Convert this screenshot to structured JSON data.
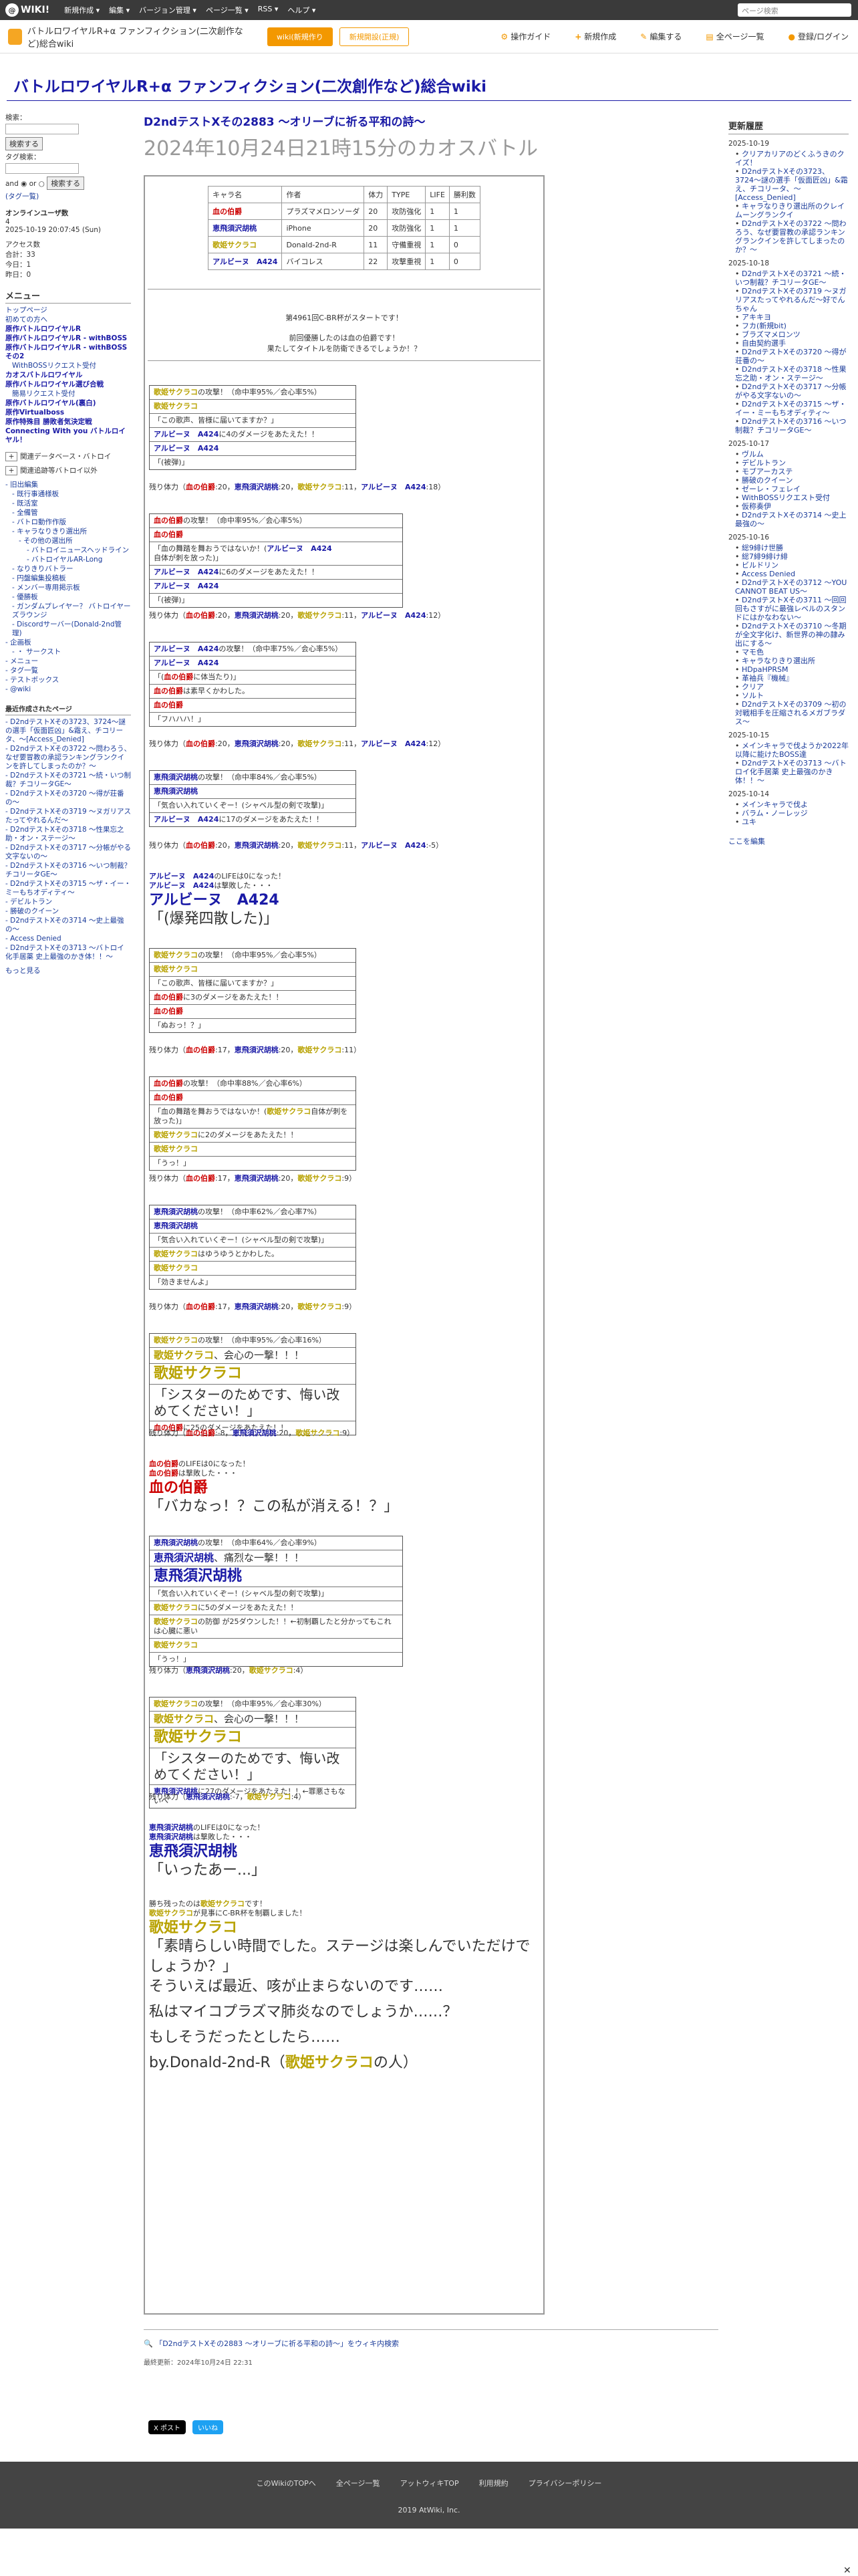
{
  "topbar": {
    "logo": "WIKI!",
    "menu": [
      "新規作成 ▾",
      "編集 ▾",
      "バージョン管理 ▾",
      "ページ一覧 ▾",
      "RSS ▾",
      "ヘルプ ▾"
    ],
    "search_placeholder": "ページ検索"
  },
  "toolbar": {
    "site_name": "バトルロワイヤルR+α ファンフィクション(二次創作など)総合wiki",
    "btn_wiki": "wiki(新規作り",
    "btn_rent": "新規開設(正規)",
    "actions": [
      {
        "icon": "⚙",
        "label": "操作ガイド"
      },
      {
        "icon": "+",
        "label": "新規作成"
      },
      {
        "icon": "✎",
        "label": "編集する"
      },
      {
        "icon": "▤",
        "label": "全ページ一覧"
      },
      {
        "icon": "●",
        "label": "登録/ログイン"
      }
    ]
  },
  "wiki_title": "バトルロワイヤルR+α ファンフィクション(二次創作など)総合wiki",
  "left": {
    "search_label1": "検索：",
    "search_button": "検索する",
    "tag_label": "タグ検索：",
    "and_or": "and ◉ or ○",
    "search_button2": "検索する",
    "tag_link": "(タグ一覧)",
    "online_label": "オンラインユーザ数",
    "online_count": "4",
    "online_time": "2025-10-19 20:07:45 (Sun)",
    "counter": [
      "アクセス数",
      "合計：33",
      "今日：1",
      "昨日：0"
    ],
    "menu_title": "メニュー",
    "menu": [
      {
        "label": "トップページ",
        "level": 0,
        "bold": false
      },
      {
        "label": "初めての方へ",
        "level": 0,
        "bold": false
      },
      {
        "label": "原作バトルロワイヤルR",
        "level": 0,
        "bold": true
      },
      {
        "label": "原作バトルロワイヤルR - withBOSS",
        "level": 0,
        "bold": true
      },
      {
        "label": "原作バトルロワイヤルR - withBOSSその2",
        "level": 0,
        "bold": true
      },
      {
        "label": "WithBOSSリクエスト受付",
        "level": 1,
        "bold": false
      },
      {
        "label": "カオスバトルロワイヤル",
        "level": 0,
        "bold": true
      },
      {
        "label": "原作バトルロワイヤル選び合戦",
        "level": 0,
        "bold": true
      },
      {
        "label": "簡易リクエスト受付",
        "level": 1,
        "bold": false
      },
      {
        "label": "原作バトルロワイヤル(裏白)",
        "level": 0,
        "bold": true
      },
      {
        "label": "原作Virtualboss",
        "level": 0,
        "bold": true
      },
      {
        "label": "原作特殊目 勝敗者気決定戦",
        "level": 0,
        "bold": true
      },
      {
        "label": "Connecting With you バトルロイヤル！",
        "level": 0,
        "bold": true
      }
    ],
    "fold1": "関連データベース・バトロイ",
    "fold2": "関連追跡等バトロイ以外",
    "tree": [
      {
        "label": "旧出編集",
        "level": 0
      },
      {
        "label": "既行事通様板",
        "level": 1
      },
      {
        "label": "既活室",
        "level": 1
      },
      {
        "label": "全備管",
        "level": 1
      },
      {
        "label": "バトロ動作作版",
        "level": 1
      },
      {
        "label": "キャラなりきり選出所",
        "level": 1
      },
      {
        "label": "その他の選出所",
        "level": 2
      },
      {
        "label": "バトロイニュースヘッドライン",
        "level": 3
      },
      {
        "label": "バトロイヤルAR-Long",
        "level": 3
      },
      {
        "label": "なりきりバトラー",
        "level": 1
      },
      {
        "label": "円盤編集投稿板",
        "level": 1
      },
      {
        "label": "メンバー専用掲示板",
        "level": 1
      },
      {
        "label": "優勝板",
        "level": 1
      },
      {
        "label": "ガンダムプレイヤー？ バトロイヤーズラウンジ",
        "level": 1
      },
      {
        "label": "Discordサーバー(Donald-2nd管理)",
        "level": 1
      },
      {
        "label": "企画板",
        "level": 0
      },
      {
        "label": "・ サークスト",
        "level": 1
      },
      {
        "label": "メニュー",
        "level": 0
      },
      {
        "label": "タグ一覧",
        "level": 0
      },
      {
        "label": "テストボックス",
        "level": 0
      },
      {
        "label": "@wiki",
        "level": 0
      }
    ],
    "recent_title": "最近作成されたページ",
    "recent": [
      "D2ndテストXその3723、3724〜謎の選手「仮面匠凶」&霜え、チコリータ、〜[Access_Denied]",
      "D2ndテストXその3722 〜問わろう、なぜ要冒教の承認ランキングランクインを許してしまったのか？〜",
      "D2ndテストXその3721 〜続・いつ制裁？チコリータGE〜",
      "D2ndテストXその3720 〜得が荘番の〜",
      "D2ndテストXその3719 〜ヌガリアスたってやれるんだ〜",
      "D2ndテストXその3718 〜性果忘之助・オン・ステージ〜",
      "D2ndテストXその3717 〜分帳がやる文字ないの〜",
      "D2ndテストXその3716 〜いつ制裁？チコリータGE〜",
      "D2ndテストXその3715 〜ザ・イー・ミーもちオディティ〜",
      "デビルトラン",
      "勝破のクイーン",
      "D2ndテストXその3714 〜史上最強の〜",
      "Access Denied",
      "D2ndテストXその3713 〜バトロイ化手居薬 史上最強のかき体！！〜"
    ],
    "more": "もっと見る"
  },
  "right": {
    "title": "更新履歴",
    "groups": [
      {
        "date": "2025-10-19",
        "items": [
          "クリアカリアのどくふうきのクイズ！",
          "D2ndテストXその3723、3724〜謎の選手「仮面匠凶」&霜え、チコリータ、〜[Access_Denied]",
          "キャラなりきり選出所のクレイムーングランクイ",
          "D2ndテストXその3722 〜問わろう、なぜ要冒教の承認ランキングランクインを許してしまったのか？〜"
        ]
      },
      {
        "date": "2025-10-18",
        "items": [
          "D2ndテストXその3721 〜続・いつ制裁？チコリータGE〜",
          "D2ndテストXその3719 〜ヌガリアスたってやれるんだ〜好でんちゃん",
          "アキキヨ",
          "フカ(新規bit)",
          "ブラズマメロンツ",
          "自由契約選手",
          "D2ndテストXその3720 〜得が荘番の〜",
          "D2ndテストXその3718 〜性果忘之助・オン・ステージ〜",
          "D2ndテストXその3717 〜分帳がやる文字ないの〜",
          "D2ndテストXその3715 〜ザ・イー・ミーもちオディティ〜",
          "D2ndテストXその3716 〜いつ制裁？チコリータGE〜"
        ]
      },
      {
        "date": "2025-10-17",
        "items": [
          "ヴルム",
          "デビルトラン",
          "モブアーカステ",
          "勝破のクイーン",
          "ゼーレ・フェレイ",
          "WithBOSSリクエスト受付",
          "仮称奏伊",
          "D2ndテストXその3714 〜史上最強の〜"
        ]
      },
      {
        "date": "2025-10-16",
        "items": [
          "総9緋け世勝",
          "総7緋9緋け緋",
          "ビルドリン",
          "Access Denied",
          "D2ndテストXその3712 〜YOU CANNOT BEAT US〜",
          "D2ndテストXその3711 〜回回回もさすがに最強レベルのスタンドにはかなわない〜",
          "D2ndテストXその3710 〜冬期が全文字化け、新世界の神の隷み出にする〜",
          "マモ色",
          "キャラなりきり選出所",
          "HDpaHPRSM",
          "革袖兵『機械』",
          "クリア",
          "ソルト",
          "D2ndテストXその3709 〜初の対戦相手を圧縮されるメガブラダス〜"
        ]
      },
      {
        "date": "2025-10-15",
        "items": [
          "メインキャラで伐ようか2022年以降に能けたBOSS達",
          "D2ndテストXその3713 〜バトロイ化手居薬 史上最強のかき体！！〜"
        ]
      },
      {
        "date": "2025-10-14",
        "items": [
          "メインキャラで伐よ",
          "バラム・ノーレッジ",
          "ユキ"
        ]
      }
    ],
    "more": "ここを編集"
  },
  "page": {
    "h1": "D2ndテストXその2883 〜オリーブに祈る平和の詩〜",
    "h2": "2024年10月24日21時15分のカオスバトル",
    "status_table": {
      "headers": [
        "キャラ名",
        "作者",
        "体力",
        "TYPE",
        "LIFE",
        "勝利数"
      ],
      "rows": [
        [
          "血の伯爵",
          "プラズマメロンソーダ",
          "20",
          "攻防強化",
          "1",
          "1"
        ],
        [
          "恵飛須沢胡桃",
          "iPhone",
          "20",
          "攻防強化",
          "1",
          "1"
        ],
        [
          "歌姫サクラコ",
          "Donald-2nd-R",
          "11",
          "守備重視",
          "1",
          "0"
        ],
        [
          "アルビーヌ　A424",
          "バイコレス",
          "22",
          "攻撃重視",
          "1",
          "0"
        ]
      ]
    },
    "intro1": "第4961回C-BR杯がスタートです！",
    "intro2": "前回優勝したのは血の伯爵です！",
    "intro3": "果たしてタイトルを防衛できるでしょうか！？",
    "blocks": [
      {
        "rows": [
          "歌姫サクラコの攻撃！（命中率95%／会心率5%）",
          "歌姫サクラコ",
          "「この歌声、皆様に届いてますか？」",
          "アルビーヌ　A424に4のダメージをあたえた！！",
          "アルビーヌ　A424",
          "「(被弾)」"
        ],
        "life": "残り体力（血の伯爵:20，恵飛須沢胡桃:20，歌姫サクラコ:11，アルビーヌ　A424:18）"
      },
      {
        "rows": [
          "血の伯爵の攻撃！（命中率95%／会心率5%）",
          "血の伯爵",
          "「血の舞踏を舞おうではないか！(アルビーヌ　A424自体が刺を放った)」",
          "アルビーヌ　A424に6のダメージをあたえた！！",
          "アルビーヌ　A424",
          "「(被弾)」"
        ],
        "life": "残り体力（血の伯爵:20，恵飛須沢胡桃:20，歌姫サクラコ:11，アルビーヌ　A424:12）"
      },
      {
        "rows": [
          "アルビーヌ　A424の攻撃！（命中率75%／会心率5%）",
          "アルビーヌ　A424",
          "「(血の伯爵に体当たり)」",
          "血の伯爵は素早くかわした。",
          "血の伯爵",
          "「フハハハ！」"
        ],
        "life": "残り体力（血の伯爵:20，恵飛須沢胡桃:20，歌姫サクラコ:11，アルビーヌ　A424:12）"
      },
      {
        "rows": [
          "恵飛須沢胡桃の攻撃！（命中率84%／会心率5%）",
          "恵飛須沢胡桃",
          "「気合い入れていくぞー！(シャベル型の剣で攻撃)」",
          "アルビーヌ　A424に17のダメージをあたえた！！"
        ],
        "life": "残り体力（血の伯爵:20，恵飛須沢胡桃:20，歌姫サクラコ:11，アルビーヌ　A424:-5）"
      },
      {
        "death": [
          "アルビーヌ　A424のLIFEは0になった！",
          "アルビーヌ　A424は撃敗した・・・"
        ],
        "death_name": "アルビーヌ　A424",
        "death_line": "「(爆発四散した)」"
      },
      {
        "rows": [
          "歌姫サクラコの攻撃！（命中率95%／会心率5%）",
          "歌姫サクラコ",
          "「この歌声、皆様に届いてますか？」",
          "血の伯爵に3のダメージをあたえた！！",
          "血の伯爵",
          "「ぬおっ！？」"
        ],
        "life": "残り体力（血の伯爵:17，恵飛須沢胡桃:20，歌姫サクラコ:11）"
      },
      {
        "rows": [
          "血の伯爵の攻撃！（命中率88%／会心率6%）",
          "血の伯爵",
          "「血の舞踏を舞おうではないか！(歌姫サクラコ自体が刺を放った)」",
          "歌姫サクラコに2のダメージをあたえた！！",
          "歌姫サクラコ",
          "「うっ！」"
        ],
        "life": "残り体力（血の伯爵:17，恵飛須沢胡桃:20，歌姫サクラコ:9）"
      },
      {
        "rows": [
          "恵飛須沢胡桃の攻撃！（命中率62%／会心率7%）",
          "恵飛須沢胡桃",
          "「気合い入れていくぞー！(シャベル型の剣で攻撃)」",
          "歌姫サクラコはゆうゆうとかわした。",
          "歌姫サクラコ",
          "「効きませんよ」"
        ],
        "life": "残り体力（血の伯爵:17，恵飛須沢胡桃:20，歌姫サクラコ:9）"
      },
      {
        "rows": [
          "歌姫サクラコの攻撃！（命中率95%／会心率16%）",
          "歌姫サクラコ、会心の一撃！！！",
          "歌姫サクラコ",
          "「シスターのためです、悔い改めてください！」",
          "血の伯爵に25のダメージをあたえた！！"
        ],
        "life": "残り体力（血の伯爵:-8，恵飛須沢胡桃:20，歌姫サクラコ:9）"
      },
      {
        "death": [
          "血の伯爵のLIFEは0になった！",
          "血の伯爵は撃敗した・・・"
        ],
        "death_name": "血の伯爵",
        "death_line": "「バカなっ！？この私が消える！？」"
      },
      {
        "rows": [
          "恵飛須沢胡桃の攻撃！（命中率64%／会心率9%）",
          "恵飛須沢胡桃、痛烈な一撃！！！",
          "恵飛須沢胡桃",
          "「気合い入れていくぞー！(シャベル型の剣で攻撃)」",
          "歌姫サクラコに5のダメージをあたえた！！",
          "歌姫サクラコの防御 が25ダウンした！！←初制覇したと分かってもこれは心臓に悪い",
          "歌姫サクラコ",
          "「うっ！」"
        ],
        "life": "残り体力（恵飛須沢胡桃:20，歌姫サクラコ:4）"
      },
      {
        "rows": [
          "歌姫サクラコの攻撃！（命中率95%／会心率30%）",
          "歌姫サクラコ、会心の一撃！！！",
          "歌姫サクラコ",
          "「シスターのためです、悔い改めてください！」",
          "恵飛須沢胡桃に27のダメージをあたえた！！←罪悪さもないへ"
        ],
        "life": "残り体力（恵飛須沢胡桃:-7，歌姫サクラコ:4）"
      },
      {
        "death": [
          "恵飛須沢胡桃のLIFEは0になった！",
          "恵飛須沢胡桃は撃敗した・・・"
        ],
        "death_name": "恵飛須沢胡桃",
        "death_line": "「いったあー...」"
      }
    ],
    "winner1": "勝ち残ったのは歌姫サクラコです！",
    "winner2": "歌姫サクラコが見事にC-BR杯を制覇しました！",
    "winner_name": "歌姫サクラコ",
    "closing": [
      "「素晴らしい時間でした。ステージは楽しんでいただけでしょうか？」",
      "そういえば最近、咳が止まらないのです……",
      "私はマイコプラズマ肺炎なのでしょうか……？",
      "もしそうだったとしたら……",
      "by.Donald-2nd-R（歌姫サクラコの人）"
    ],
    "wiki_link": "「D2ndテストXその2883 〜オリーブに祈る平和の詩〜」をウィキ内検索",
    "last_updated": "最終更新：2024年10月24日 22:31",
    "share_post": "X ポスト",
    "share_like": "いいね"
  },
  "footer": {
    "links": [
      "このWikiのTOPへ",
      "全ページ一覧",
      "アットウィキTOP",
      "利用規約",
      "プライバシーポリシー"
    ],
    "copy": "2019 AtWiki, Inc."
  },
  "colors": {
    "accent": "#f39800",
    "title": "#1a1aa6",
    "red": "#cc0000",
    "yellow": "#b8a200"
  }
}
